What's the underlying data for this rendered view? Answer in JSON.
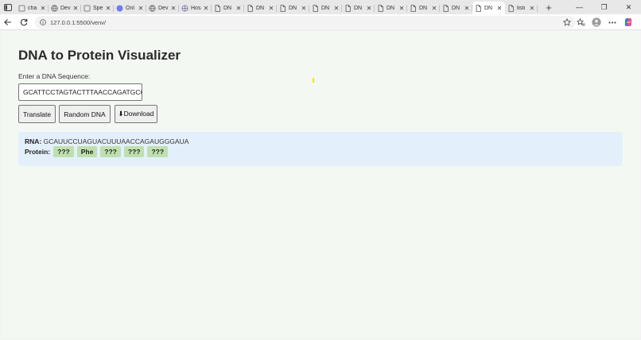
{
  "browser": {
    "tabs": [
      {
        "title": "cha",
        "icon": "generic-page-icon"
      },
      {
        "title": "Dev",
        "icon": "globe-icon"
      },
      {
        "title": "Spe",
        "icon": "generic-page-icon"
      },
      {
        "title": "Onl",
        "icon": "circle-icon"
      },
      {
        "title": "Dev",
        "icon": "globe-icon"
      },
      {
        "title": "Hos",
        "icon": "network-icon"
      },
      {
        "title": "DN",
        "icon": "document-icon"
      },
      {
        "title": "DN",
        "icon": "document-icon"
      },
      {
        "title": "DN",
        "icon": "document-icon"
      },
      {
        "title": "DN",
        "icon": "document-icon"
      },
      {
        "title": "DN",
        "icon": "document-icon"
      },
      {
        "title": "DN",
        "icon": "document-icon"
      },
      {
        "title": "DN",
        "icon": "document-icon"
      },
      {
        "title": "DN",
        "icon": "document-icon"
      },
      {
        "title": "DN",
        "icon": "document-icon",
        "active": true
      },
      {
        "title": "listi",
        "icon": "document-icon"
      }
    ],
    "url": "127.0.0.1:5500/venv/"
  },
  "page": {
    "title": "DNA to Protein Visualizer",
    "input_label": "Enter a DNA Sequence:",
    "dna_value": "GCATTCCTAGTACTTTAACCAGATGCCCTAT",
    "buttons": {
      "translate": "Translate",
      "random": "Random DNA",
      "download": "⬇Download"
    },
    "result": {
      "rna_label": "RNA:",
      "rna_value": "GCAUUCCUAGUACUUUAACCAGAUGGGAUA",
      "protein_label": "Protein:",
      "amino_acids": [
        "???",
        "Phe",
        "???",
        "???",
        "???"
      ]
    }
  },
  "colors": {
    "page_bg": "#f4f8f3",
    "result_bg": "#e3f0fb",
    "amino_bg": "#bfe0ae"
  }
}
